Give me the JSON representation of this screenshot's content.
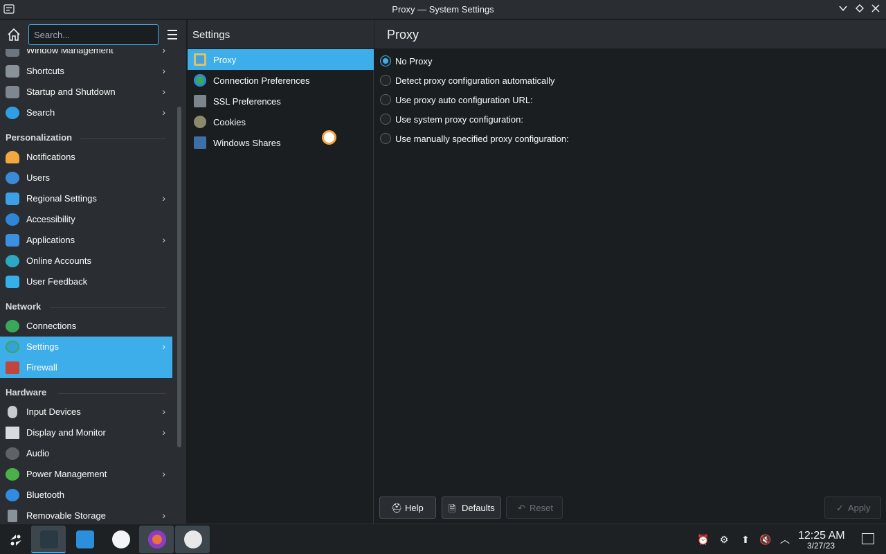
{
  "window": {
    "title": "Proxy — System Settings",
    "controls": [
      "chevron-down-icon",
      "diamond-icon",
      "close-icon"
    ]
  },
  "search": {
    "placeholder": "Search...",
    "value": ""
  },
  "sidebar": {
    "items_top": [
      {
        "label": "Window Management",
        "icon": "window-icon",
        "color": "#6c7680",
        "chevron": true
      },
      {
        "label": "Shortcuts",
        "icon": "keyboard-icon",
        "color": "#8a9299",
        "chevron": true
      },
      {
        "label": "Startup and Shutdown",
        "icon": "monitor-icon",
        "color": "#7e8790",
        "chevron": true
      },
      {
        "label": "Search",
        "icon": "search-icon",
        "color": "#2f9ee6",
        "chevron": true
      }
    ],
    "section_personalization": "Personalization",
    "items_personal": [
      {
        "label": "Notifications",
        "icon": "bell-icon",
        "color": "#f3a73f",
        "chevron": false
      },
      {
        "label": "Users",
        "icon": "users-icon",
        "color": "#3a8ad8",
        "chevron": false
      },
      {
        "label": "Regional Settings",
        "icon": "flag-icon",
        "color": "#3da0e6",
        "chevron": true
      },
      {
        "label": "Accessibility",
        "icon": "accessibility-icon",
        "color": "#2f86d6",
        "chevron": false
      },
      {
        "label": "Applications",
        "icon": "apps-icon",
        "color": "#3d90e0",
        "chevron": true
      },
      {
        "label": "Online Accounts",
        "icon": "globe-icon",
        "color": "#2ba8c2",
        "chevron": false
      },
      {
        "label": "User Feedback",
        "icon": "feedback-icon",
        "color": "#35b0e8",
        "chevron": false
      }
    ],
    "section_network": "Network",
    "items_network": [
      {
        "label": "Connections",
        "icon": "globe-icon",
        "color": "#3aa85a",
        "chevron": false
      },
      {
        "label": "Settings",
        "icon": "globe-icon",
        "color": "#36a2d8",
        "chevron": true
      },
      {
        "label": "Firewall",
        "icon": "firewall-icon",
        "color": "#c0453f",
        "chevron": false
      }
    ],
    "section_hardware": "Hardware",
    "items_hardware": [
      {
        "label": "Input Devices",
        "icon": "mouse-icon",
        "color": "#c8cbce",
        "chevron": true
      },
      {
        "label": "Display and Monitor",
        "icon": "display-icon",
        "color": "#d8dadd",
        "chevron": true
      },
      {
        "label": "Audio",
        "icon": "speaker-icon",
        "color": "#5d6369",
        "chevron": false
      },
      {
        "label": "Power Management",
        "icon": "power-icon",
        "color": "#4ab04a",
        "chevron": true
      },
      {
        "label": "Bluetooth",
        "icon": "bluetooth-icon",
        "color": "#2f8ce0",
        "chevron": false
      },
      {
        "label": "Removable Storage",
        "icon": "usb-icon",
        "color": "#8a9299",
        "chevron": true
      }
    ]
  },
  "middle": {
    "title": "Settings",
    "items": [
      {
        "label": "Proxy",
        "icon": "proxy-icon",
        "color": "#4aa0d8"
      },
      {
        "label": "Connection Preferences",
        "icon": "globe-icon",
        "color": "#3aa85a"
      },
      {
        "label": "SSL Preferences",
        "icon": "ssl-icon",
        "color": "#7d858c"
      },
      {
        "label": "Cookies",
        "icon": "cookie-icon",
        "color": "#8c8a6d"
      },
      {
        "label": "Windows Shares",
        "icon": "shares-icon",
        "color": "#3d6fa8"
      }
    ]
  },
  "content": {
    "title": "Proxy",
    "options": [
      {
        "label": "No Proxy",
        "selected": true
      },
      {
        "label": "Detect proxy configuration automatically",
        "selected": false
      },
      {
        "label": "Use proxy auto configuration URL:",
        "selected": false
      },
      {
        "label": "Use system proxy configuration:",
        "selected": false
      },
      {
        "label": "Use manually specified proxy configuration:",
        "selected": false
      }
    ],
    "buttons": {
      "help": "Help",
      "defaults": "Defaults",
      "reset": "Reset",
      "apply": "Apply"
    }
  },
  "taskbar": {
    "apps": [
      "launcher-icon",
      "system-settings-icon",
      "discover-icon",
      "steam-deck-icon",
      "firefox-icon",
      "vm-icon"
    ],
    "tray": [
      "notification-icon",
      "network-icon",
      "update-icon",
      "volume-muted-icon",
      "tray-expand-icon"
    ],
    "time": "12:25 AM",
    "date": "3/27/23"
  },
  "colors": {
    "accent": "#3daee9",
    "window_bg": "#1b1e20",
    "panel_bg": "#2a2e32"
  }
}
